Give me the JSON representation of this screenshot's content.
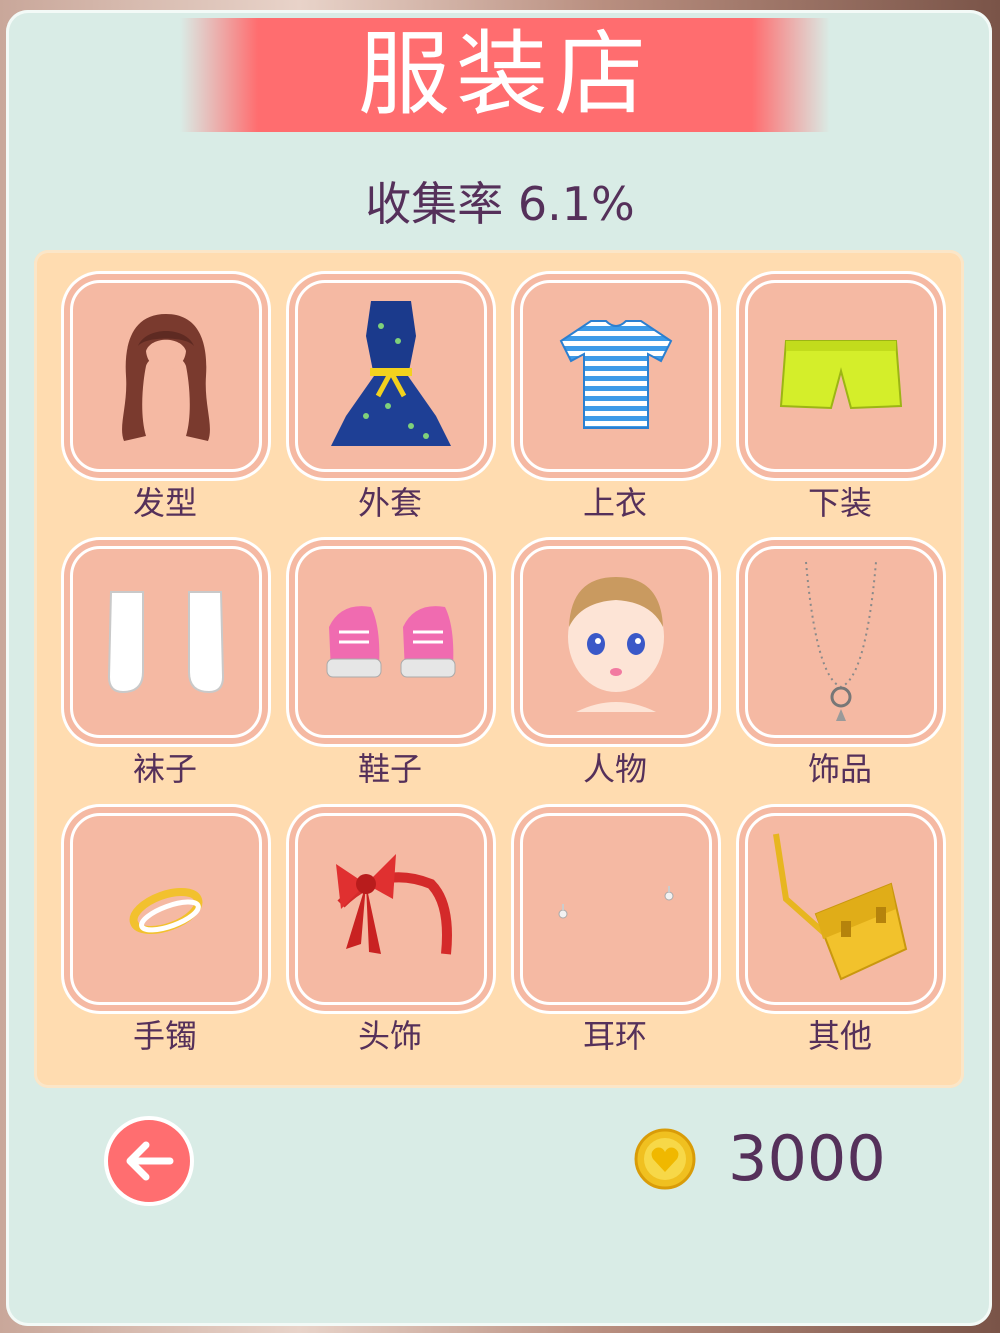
{
  "header": {
    "title": "服装店",
    "collection_rate": "收集率 6.1%"
  },
  "categories": [
    {
      "label": "发型",
      "icon": "hairstyle-icon"
    },
    {
      "label": "外套",
      "icon": "dress-icon"
    },
    {
      "label": "上衣",
      "icon": "striped-shirt-icon"
    },
    {
      "label": "下装",
      "icon": "shorts-icon"
    },
    {
      "label": "袜子",
      "icon": "socks-icon"
    },
    {
      "label": "鞋子",
      "icon": "sneakers-icon"
    },
    {
      "label": "人物",
      "icon": "character-face-icon"
    },
    {
      "label": "饰品",
      "icon": "necklace-icon"
    },
    {
      "label": "手镯",
      "icon": "bracelet-icon"
    },
    {
      "label": "头饰",
      "icon": "headband-icon"
    },
    {
      "label": "耳环",
      "icon": "earrings-icon"
    },
    {
      "label": "其他",
      "icon": "bag-icon"
    }
  ],
  "footer": {
    "coins": "3000",
    "back_icon": "arrow-left-icon",
    "coin_icon": "heart-coin-icon"
  },
  "colors": {
    "accent": "#ff6e70",
    "panel": "#d9ece6",
    "grid": "#ffdcb0",
    "tile": "#f5b9a3",
    "text": "#55305a"
  }
}
